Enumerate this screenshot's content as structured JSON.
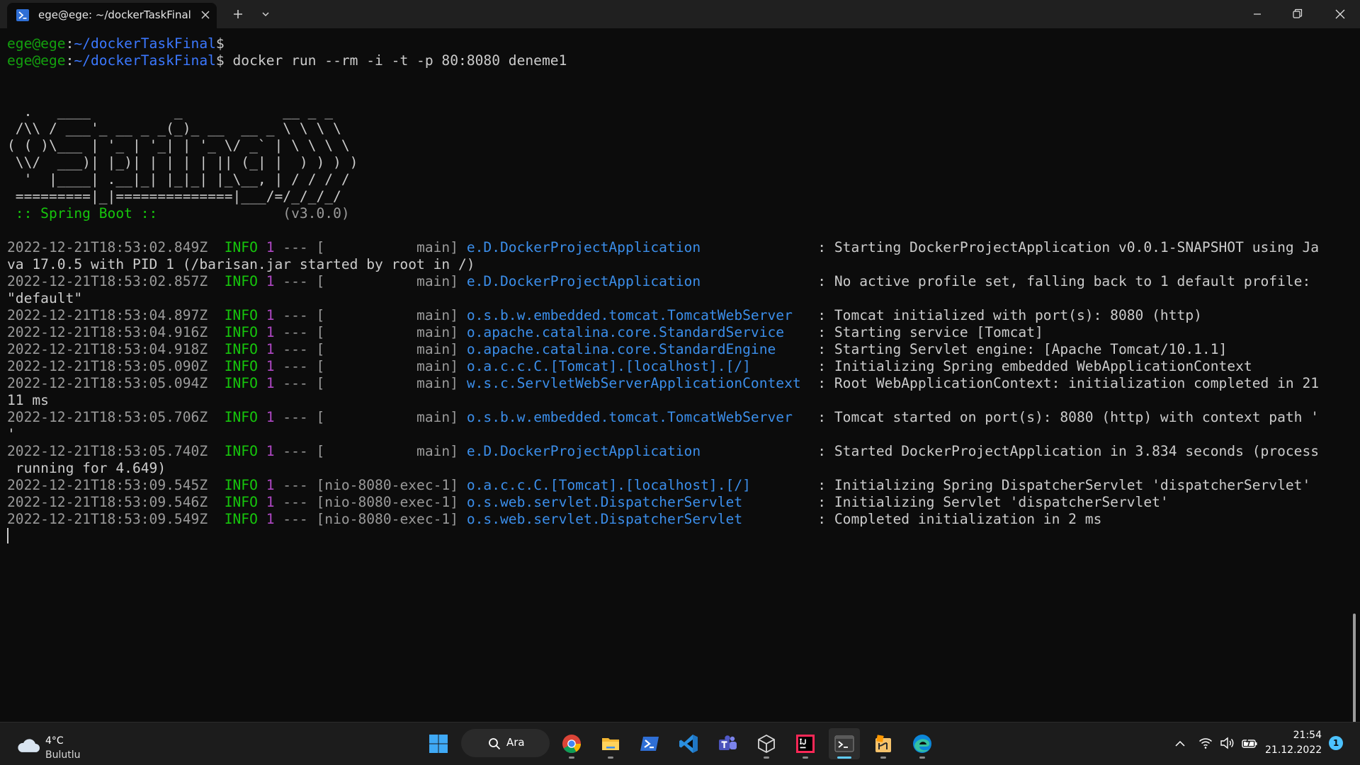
{
  "tab": {
    "title": "ege@ege: ~/dockerTaskFinal"
  },
  "terminal": {
    "colors": {
      "default": "#cccccc",
      "prompt_user": "#13a10e",
      "prompt_path": "#3b78ff",
      "timestamp": "#9a9a9a",
      "info": "#16c60c",
      "pid": "#b148c6",
      "dim": "#9a9a9a",
      "logger": "#3b8eea",
      "banner_green": "#16c60c"
    },
    "prompt": {
      "user": "ege@ege",
      "sep": ":",
      "path": "~/dockerTaskFinal",
      "symbol": "$"
    },
    "command": " docker run --rm -i -t -p 80:8080 deneme1",
    "banner": [
      "  .   ____          _            __ _ _",
      " /\\\\ / ___'_ __ _ _(_)_ __  __ _ \\ \\ \\ \\",
      "( ( )\\___ | '_ | '_| | '_ \\/ _` | \\ \\ \\ \\",
      " \\\\/  ___)| |_)| | | | | || (_| |  ) ) ) )",
      "  '  |____| .__|_| |_|_| |_\\__, | / / / /",
      " =========|_|==============|___/=/_/_/_/"
    ],
    "spring_boot": {
      "label": " :: Spring Boot :: ",
      "version": "              (v3.0.0)"
    },
    "logs": [
      {
        "ts": "2022-12-21T18:53:02.849Z",
        "thread": "           main",
        "logger": "e.D.DockerProjectApplication             ",
        "message": "Starting DockerProjectApplication v0.0.1-SNAPSHOT using Ja",
        "cont": "va 17.0.5 with PID 1 (/barisan.jar started by root in /)"
      },
      {
        "ts": "2022-12-21T18:53:02.857Z",
        "thread": "           main",
        "logger": "e.D.DockerProjectApplication             ",
        "message": "No active profile set, falling back to 1 default profile:",
        "cont": "\"default\""
      },
      {
        "ts": "2022-12-21T18:53:04.897Z",
        "thread": "           main",
        "logger": "o.s.b.w.embedded.tomcat.TomcatWebServer  ",
        "message": "Tomcat initialized with port(s): 8080 (http)",
        "cont": ""
      },
      {
        "ts": "2022-12-21T18:53:04.916Z",
        "thread": "           main",
        "logger": "o.apache.catalina.core.StandardService   ",
        "message": "Starting service [Tomcat]",
        "cont": ""
      },
      {
        "ts": "2022-12-21T18:53:04.918Z",
        "thread": "           main",
        "logger": "o.apache.catalina.core.StandardEngine    ",
        "message": "Starting Servlet engine: [Apache Tomcat/10.1.1]",
        "cont": ""
      },
      {
        "ts": "2022-12-21T18:53:05.090Z",
        "thread": "           main",
        "logger": "o.a.c.c.C.[Tomcat].[localhost].[/]       ",
        "message": "Initializing Spring embedded WebApplicationContext",
        "cont": ""
      },
      {
        "ts": "2022-12-21T18:53:05.094Z",
        "thread": "           main",
        "logger": "w.s.c.ServletWebServerApplicationContext ",
        "message": "Root WebApplicationContext: initialization completed in 21",
        "cont": "11 ms"
      },
      {
        "ts": "2022-12-21T18:53:05.706Z",
        "thread": "           main",
        "logger": "o.s.b.w.embedded.tomcat.TomcatWebServer  ",
        "message": "Tomcat started on port(s): 8080 (http) with context path '",
        "cont": "'"
      },
      {
        "ts": "2022-12-21T18:53:05.740Z",
        "thread": "           main",
        "logger": "e.D.DockerProjectApplication             ",
        "message": "Started DockerProjectApplication in 3.834 seconds (process",
        "cont": " running for 4.649)"
      },
      {
        "ts": "2022-12-21T18:53:09.545Z",
        "thread": "nio-8080-exec-1",
        "logger": "o.a.c.c.C.[Tomcat].[localhost].[/]       ",
        "message": "Initializing Spring DispatcherServlet 'dispatcherServlet'",
        "cont": ""
      },
      {
        "ts": "2022-12-21T18:53:09.546Z",
        "thread": "nio-8080-exec-1",
        "logger": "o.s.web.servlet.DispatcherServlet        ",
        "message": "Initializing Servlet 'dispatcherServlet'",
        "cont": ""
      },
      {
        "ts": "2022-12-21T18:53:09.549Z",
        "thread": "nio-8080-exec-1",
        "logger": "o.s.web.servlet.DispatcherServlet        ",
        "message": "Completed initialization in 2 ms",
        "cont": ""
      }
    ],
    "log_level": "INFO",
    "log_pid": "1",
    "log_sep": "---"
  },
  "taskbar": {
    "weather": {
      "temp": "4°C",
      "condition": "Bulutlu"
    },
    "search_label": "Ara",
    "apps": [
      {
        "name": "start-button-icon",
        "running": false
      },
      {
        "name": "chrome-icon",
        "running": true
      },
      {
        "name": "file-explorer-icon",
        "running": true
      },
      {
        "name": "powershell-icon",
        "running": false
      },
      {
        "name": "vscode-icon",
        "running": false
      },
      {
        "name": "teams-icon",
        "running": false
      },
      {
        "name": "virtualbox-icon",
        "running": true
      },
      {
        "name": "intellij-icon",
        "running": true
      },
      {
        "name": "terminal-icon",
        "running": true,
        "active": true
      },
      {
        "name": "sublime-merge-icon",
        "running": true
      },
      {
        "name": "edge-icon",
        "running": true
      }
    ],
    "clock": {
      "time": "21:54",
      "date": "21.12.2022"
    },
    "notification_count": "1"
  }
}
